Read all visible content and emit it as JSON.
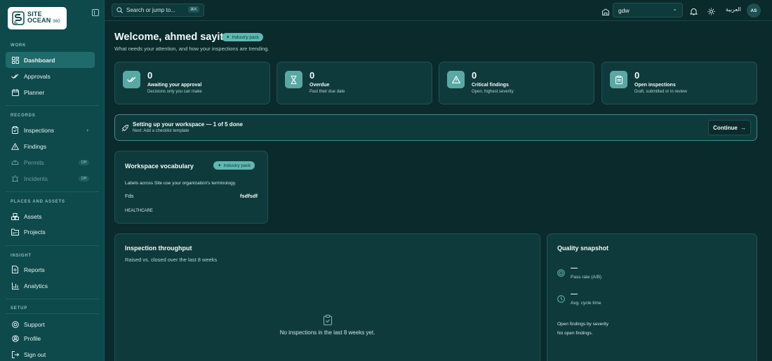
{
  "app": {
    "logo_line1": "SITE",
    "logo_line2": "OCEAN",
    "logo_sup": "360"
  },
  "sidebar": {
    "sections": {
      "work": "WORK",
      "records": "RECORDS",
      "places": "PLACES AND ASSETS",
      "insight": "INSIGHT",
      "setup": "SETUP"
    },
    "items": {
      "dashboard": "Dashboard",
      "approvals": "Approvals",
      "planner": "Planner",
      "inspections": "Inspections",
      "findings": "Findings",
      "permits": "Permits",
      "incidents": "Incidents",
      "assets": "Assets",
      "projects": "Projects",
      "reports": "Reports",
      "analytics": "Analytics",
      "support": "Support",
      "profile": "Profile",
      "signout": "Sign out"
    },
    "off_badge": "Off"
  },
  "topbar": {
    "search_placeholder": "Search or jump to...",
    "search_shortcut": "⌘K",
    "tenant": "gdw",
    "language": "العربية",
    "avatar_initials": "AS"
  },
  "header": {
    "title": "Welcome, ahmed sayit",
    "pill": "Industry pack",
    "subtitle": "What needs your attention, and how your inspections are trending."
  },
  "stats": [
    {
      "value": "0",
      "label": "Awaiting your approval",
      "sub": "Decisions only you can make",
      "icon": "double-check-icon"
    },
    {
      "value": "0",
      "label": "Overdue",
      "sub": "Past their due date",
      "icon": "hourglass-icon"
    },
    {
      "value": "0",
      "label": "Critical findings",
      "sub": "Open, highest severity",
      "icon": "warning-icon"
    },
    {
      "value": "0",
      "label": "Open inspections",
      "sub": "Draft, submitted or in review",
      "icon": "clipboard-icon"
    }
  ],
  "setup": {
    "title": "Setting up your workspace — 1 of 5 done",
    "sub": "Next: Add a checklist template",
    "button": "Continue"
  },
  "vocabulary": {
    "title": "Workspace vocabulary",
    "pill": "Industry pack",
    "desc": "Labels across Site use your organization's terminology.",
    "term_key": "Fds",
    "term_value": "fsdfsdf",
    "industry": "HEALTHCARE"
  },
  "throughput": {
    "title": "Inspection throughput",
    "sub": "Raised vs. closed over the last 8 weeks",
    "empty": "No inspections in the last 8 weeks yet."
  },
  "quality": {
    "title": "Quality snapshot",
    "pass_rate_value": "—",
    "pass_rate_label": "Pass rate (A/B)",
    "cycle_value": "—",
    "cycle_label": "Avg. cycle time",
    "severity_title": "Open findings by severity",
    "severity_empty": "No open findings."
  }
}
